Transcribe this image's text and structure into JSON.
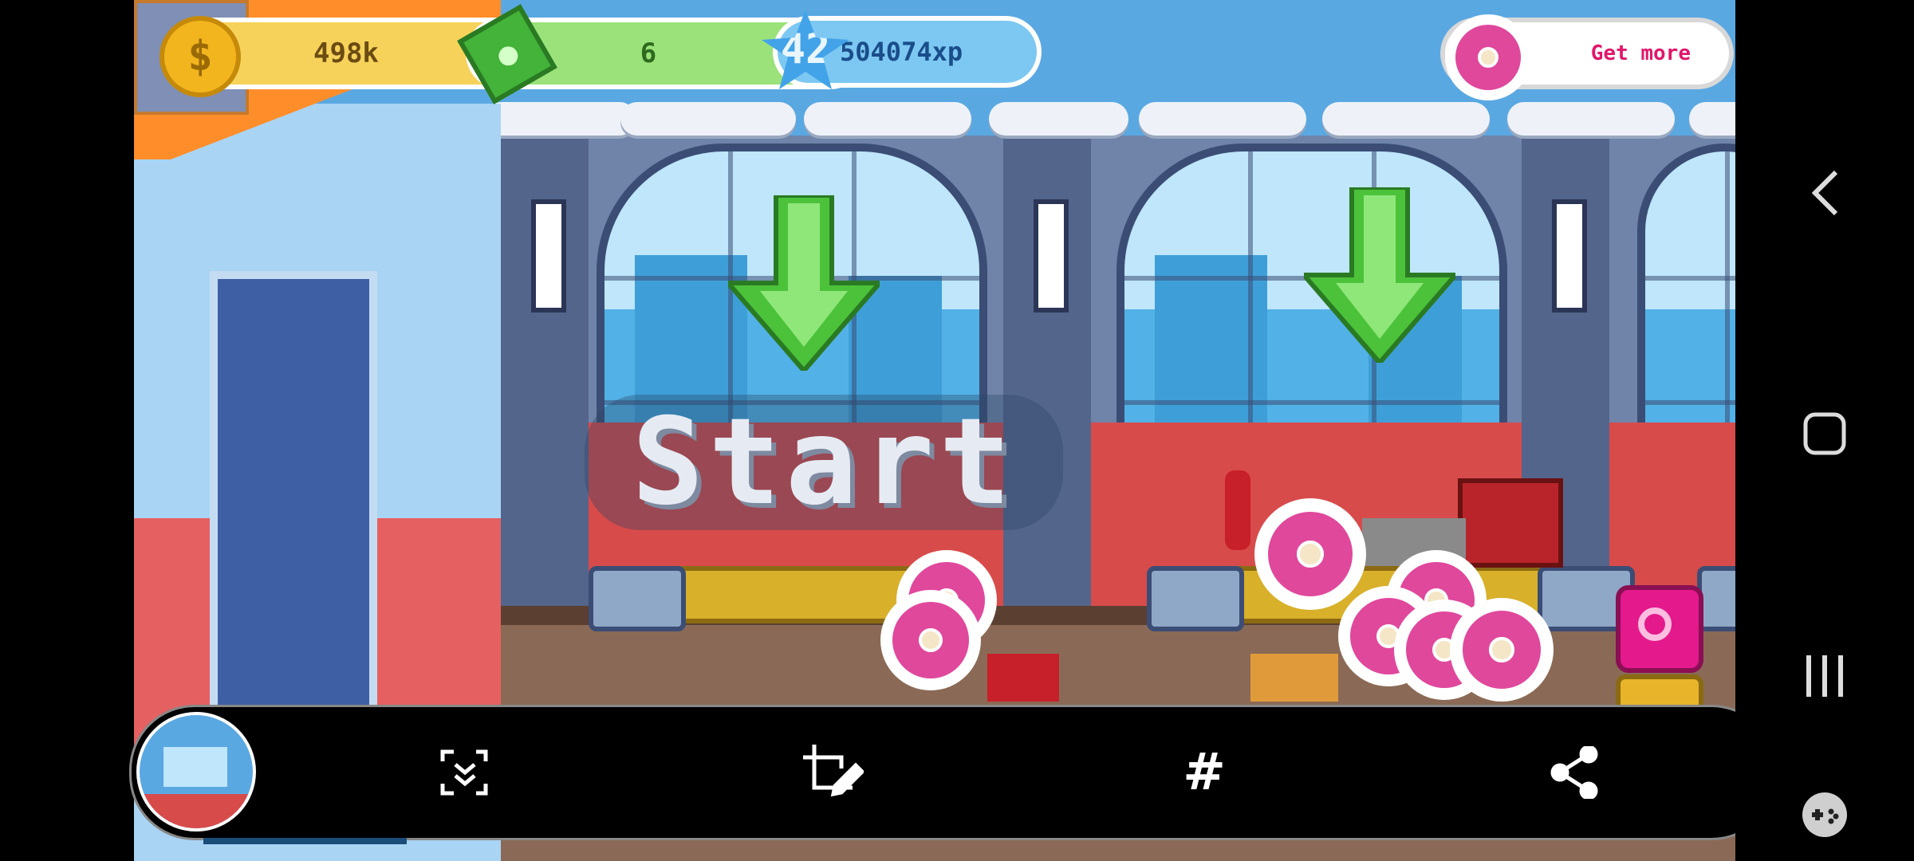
{
  "hud": {
    "coins": "498k",
    "cash": "6",
    "level": "42",
    "xp": "504074xp",
    "get_more_label": "Get more",
    "plus_symbol": "+"
  },
  "game": {
    "start_label": "Start"
  },
  "toolbar": {
    "items": [
      {
        "icon": "scroll-capture-icon"
      },
      {
        "icon": "crop-edit-icon"
      },
      {
        "icon": "hashtag-icon"
      },
      {
        "icon": "share-icon"
      }
    ],
    "hashtag_symbol": "#"
  },
  "nav": {
    "back": "back-icon",
    "home": "home-icon",
    "recents": "recents-icon",
    "game_tools": "gamepad-icon"
  },
  "colors": {
    "donut_pink": "#e0489c",
    "start_text": "#e6ebf3",
    "accent_green": "#4cc23a"
  }
}
